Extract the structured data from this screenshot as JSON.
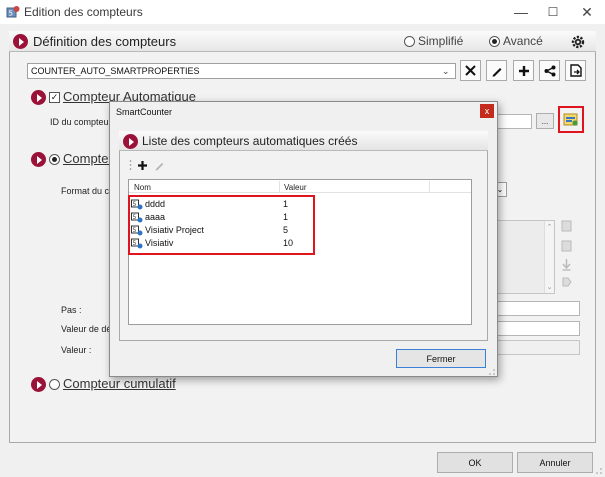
{
  "window": {
    "title": "Edition des compteurs",
    "controls": {
      "minimize": "—",
      "maximize": "☐",
      "close": "✕"
    }
  },
  "section": {
    "title": "Définition des compteurs",
    "mode_simple": "Simplifié",
    "mode_advanced": "Avancé",
    "selected_mode": "Avancé"
  },
  "combo": {
    "value": "COUNTER_AUTO_SMARTPROPERTIES"
  },
  "toolbar": {
    "buttons": [
      {
        "name": "delete-button",
        "glyph": "✕"
      },
      {
        "name": "edit-button",
        "glyph": "✎"
      },
      {
        "name": "add-button",
        "glyph": "+"
      },
      {
        "name": "share-button",
        "glyph": "share-icon"
      },
      {
        "name": "export-button",
        "glyph": "export-icon"
      }
    ]
  },
  "auto_counter": {
    "title": "Compteur Automatique",
    "checked": true,
    "id_label": "ID du compteur :",
    "browse_label": "..."
  },
  "second_counter": {
    "title_visible": "Compteu",
    "format_label_visible": "Format du cor"
  },
  "fields": {
    "pas_label": "Pas :",
    "start_label_visible": "Valeur de dép",
    "value_label": "Valeur :"
  },
  "cumulative": {
    "title": "Compteur cumulatif"
  },
  "footer": {
    "ok": "OK",
    "cancel": "Annuler"
  },
  "dialog": {
    "title": "SmartCounter",
    "close": "x",
    "panel_title": "Liste des compteurs automatiques créés",
    "columns": {
      "name": "Nom",
      "value": "Valeur"
    },
    "rows": [
      {
        "name": "dddd",
        "value": "1"
      },
      {
        "name": "aaaa",
        "value": "1"
      },
      {
        "name": "Visiativ Project",
        "value": "5"
      },
      {
        "name": "Visiativ",
        "value": "10"
      }
    ],
    "close_button": "Fermer"
  },
  "colors": {
    "accent": "#9b1239",
    "highlight": "#e0141e",
    "focus": "#3c7fd6"
  }
}
